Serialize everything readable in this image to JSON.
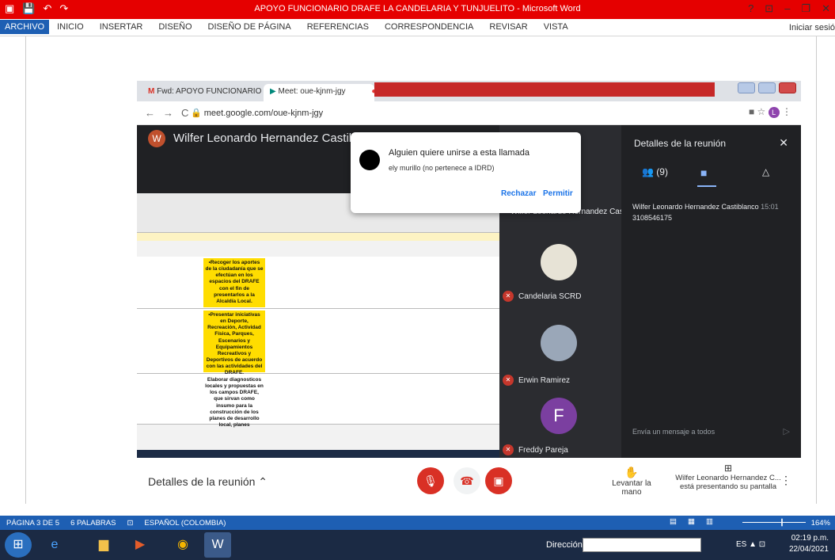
{
  "word": {
    "title": "APOYO FUNCIONARIO DRAFE LA CANDELARIA Y TUNJUELITO - Microsoft Word",
    "tabs": [
      "ARCHIVO",
      "INICIO",
      "INSERTAR",
      "DISEÑO",
      "DISEÑO DE PÁGINA",
      "REFERENCIAS",
      "CORRESPONDENCIA",
      "REVISAR",
      "VISTA"
    ],
    "signin": "Iniciar sesió",
    "status_page": "PÁGINA 3 DE 5",
    "status_words": "6 PALABRAS",
    "status_lang": "ESPAÑOL (COLOMBIA)",
    "zoom": "164%",
    "accent": "#1e5fb3",
    "titlebar_color": "#e50000"
  },
  "browser": {
    "tab1": "Fwd: APOYO FUNCIONARIO DR/",
    "tab2": "Meet: oue-kjnm-jgy",
    "url": "meet.google.com/oue-kjnm-jgy"
  },
  "meet": {
    "presenter_initial": "W",
    "presenter_banner": "Wilfer Leonardo Hernandez Castiblanco está p",
    "tile_presenter": "Wilfer Leonardo Hernandez Cas...",
    "participants": [
      {
        "name": "Candelaria SCRD"
      },
      {
        "name": "Erwin Ramirez"
      },
      {
        "name": "Freddy Pareja",
        "initial": "F"
      }
    ],
    "details_title": "Detalles de la reunión",
    "people_count": "(9)",
    "chat_author": "Wilfer Leonardo Hernandez Castiblanco",
    "chat_time": "15:01",
    "chat_text": "3108546175",
    "chat_placeholder": "Envía un mensaje a todos",
    "bottom_details": "Detalles de la reunión",
    "raise_hand": "Levantar la mano",
    "presenting": "Wilfer Leonardo Hernandez C...",
    "presenting_sub": "está presentando su pantalla"
  },
  "dialog": {
    "title": "Alguien quiere unirse a esta llamada",
    "subtitle": "ely murillo (no pertenece a IDRD)",
    "reject": "Rechazar",
    "allow": "Permitir"
  },
  "excel": {
    "cells": [
      "•Recoger los aportes de la ciudadanía que se efectúan en los espacios del DRAFE con el fin de presentarlos a la Alcaldía Local.",
      "•Presentar iniciativas en Deporte, Recreación, Actividad Física, Parques, Escenarios y Equipamientos Recreativos y Deportivos de acuerdo con las actividades del DRAFE.",
      "Elaborar diagnosticos locales y propuestas en los campos DRAFE, que sirvan como insumo para la construcción de los planes de desarrollo local, planes"
    ]
  },
  "taskbar": {
    "address_label": "Dirección",
    "lang": "ES",
    "time": "02:19 p.m.",
    "date": "22/04/2021"
  }
}
